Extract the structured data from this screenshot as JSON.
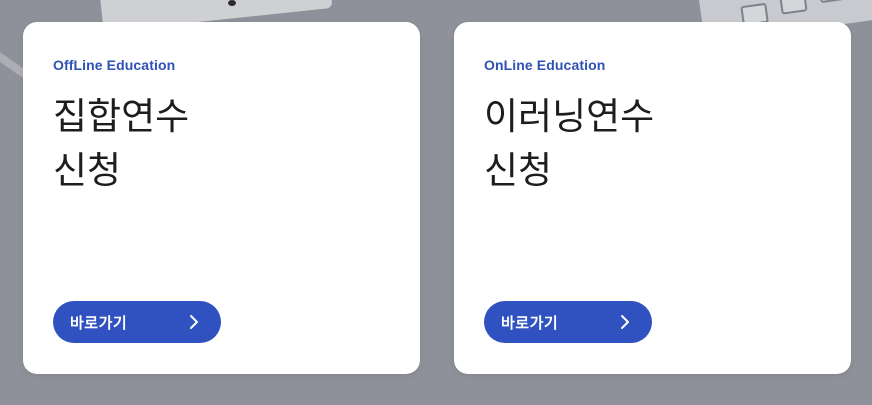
{
  "cards": [
    {
      "eyebrow": "OffLine Education",
      "title_line1": "집합연수",
      "title_line2": "신청",
      "button_label": "바로가기",
      "button_icon": "chevron-right-icon"
    },
    {
      "eyebrow": "OnLine Education",
      "title_line1": "이러닝연수",
      "title_line2": "신청",
      "button_label": "바로가기",
      "button_icon": "chevron-right-icon"
    }
  ],
  "colors": {
    "accent": "#2f52c0",
    "eyebrow": "#2f52b5",
    "background": "#8e9199",
    "card": "#ffffff",
    "title": "#1d1d1f"
  }
}
